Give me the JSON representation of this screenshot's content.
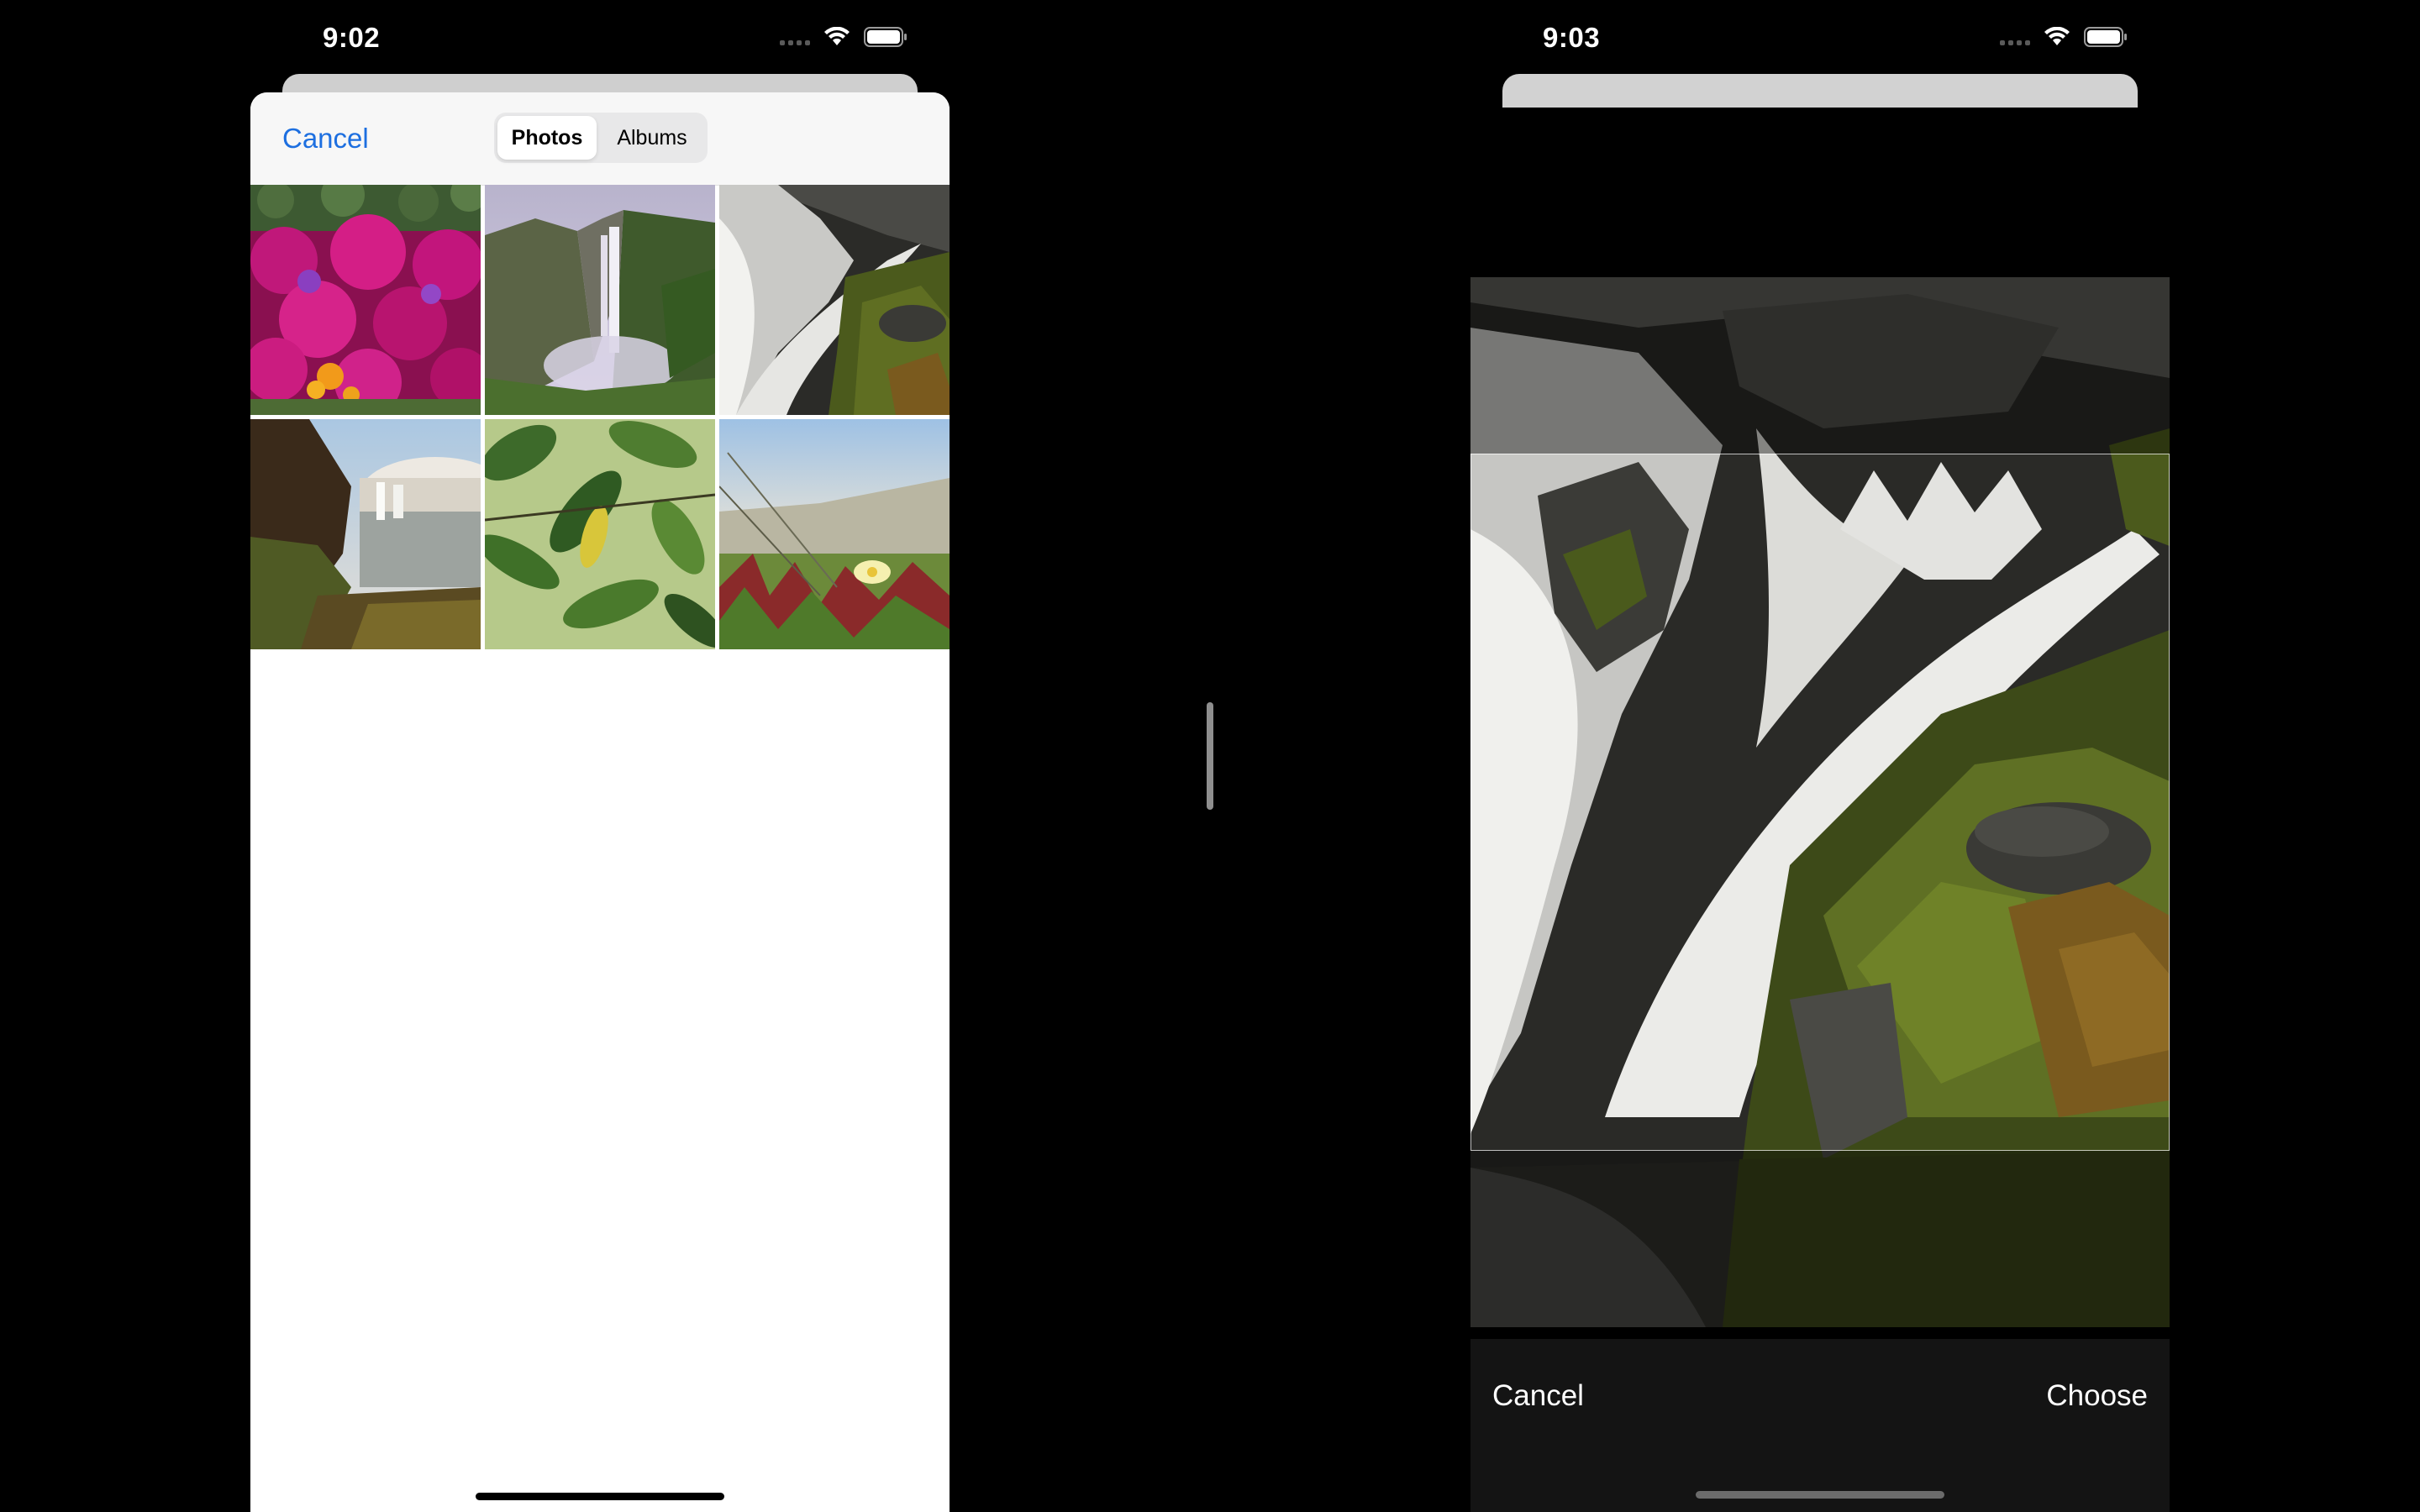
{
  "left_screen": {
    "status_bar": {
      "time": "9:02"
    },
    "picker": {
      "cancel_label": "Cancel",
      "segments": {
        "photos": "Photos",
        "albums": "Albums"
      },
      "selected_segment": "Photos",
      "thumbnails": [
        "pink-flowers-thumbnail",
        "misty-waterfall-thumbnail",
        "rocky-cascade-thumbnail",
        "coastal-waterfall-thumbnail",
        "green-leaves-thumbnail",
        "dune-grass-flower-thumbnail"
      ]
    }
  },
  "right_screen": {
    "status_bar": {
      "time": "9:03"
    },
    "crop": {
      "image": "rocky-cascade-photo",
      "cancel_label": "Cancel",
      "choose_label": "Choose"
    }
  },
  "colors": {
    "accent": "#1d6fe0",
    "background": "#000000",
    "sheet": "#ffffff",
    "toolbar": "#141414"
  },
  "icons": [
    "wifi-icon",
    "battery-icon",
    "cellular-signal-icon"
  ]
}
